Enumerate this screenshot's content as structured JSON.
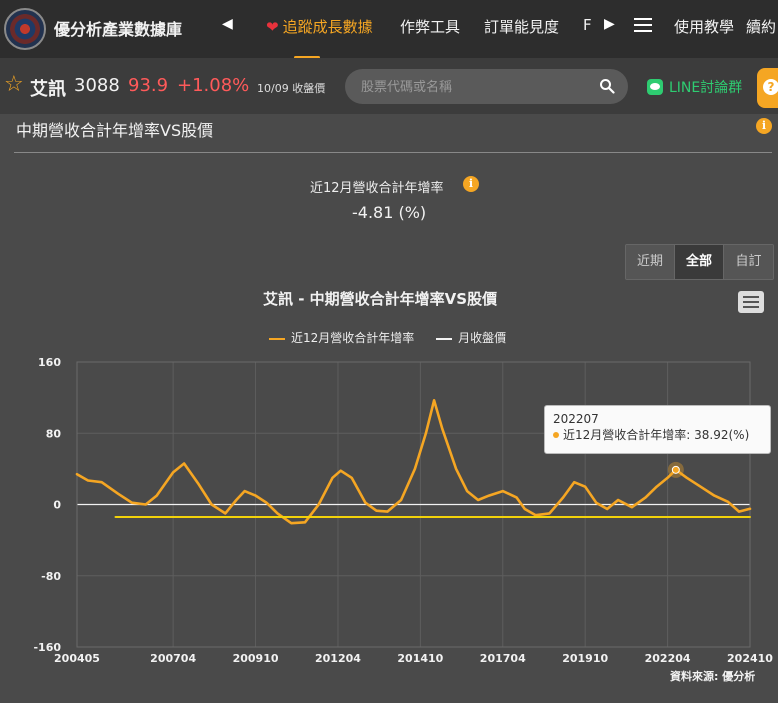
{
  "nav": {
    "brand": "優分析產業數據庫",
    "items": [
      "追蹤成長數據",
      "作弊工具",
      "訂單能見度",
      "F"
    ],
    "right_items": [
      "使用教學",
      "續約"
    ]
  },
  "stock": {
    "name": "艾訊",
    "code": "3088",
    "price": "93.9",
    "change": "+1.08%",
    "date_label": "10/09 收盤價",
    "line_label": "LINE討論群"
  },
  "search": {
    "placeholder": "股票代碼或名稱"
  },
  "section": {
    "title": "中期營收合計年增率VS股價"
  },
  "metric": {
    "label": "近12月營收合計年增率",
    "value": "-4.81 (%)"
  },
  "range_buttons": [
    "近期",
    "全部",
    "自訂"
  ],
  "tooltip": {
    "period": "202207",
    "text": "近12月營收合計年增率: 38.92(%)"
  },
  "source": "資料來源: 優分析",
  "colors": {
    "accent": "#f5a623",
    "up": "#ff5a5a",
    "price_line": "#f2d20a"
  },
  "chart_data": {
    "type": "line",
    "title": "艾訊 - 中期營收合計年增率VS股價",
    "legend": [
      "近12月營收合計年增率",
      "月收盤價"
    ],
    "x_ticks": [
      "200405",
      "200704",
      "200910",
      "201204",
      "201410",
      "201704",
      "201910",
      "202204",
      "202410"
    ],
    "y_ticks": [
      "160",
      "80",
      "0",
      "-80",
      "-160"
    ],
    "ylim": [
      -160,
      160
    ],
    "grid": true,
    "series": [
      {
        "name": "近12月營收合計年增率",
        "color": "#f5a623",
        "points": [
          [
            "2004-05",
            34
          ],
          [
            "2004-09",
            27
          ],
          [
            "2005-02",
            25
          ],
          [
            "2005-08",
            12
          ],
          [
            "2006-01",
            2
          ],
          [
            "2006-06",
            0
          ],
          [
            "2006-10",
            10
          ],
          [
            "2007-04",
            36
          ],
          [
            "2007-08",
            46
          ],
          [
            "2008-01",
            24
          ],
          [
            "2008-06",
            0
          ],
          [
            "2008-11",
            -10
          ],
          [
            "2009-03",
            5
          ],
          [
            "2009-06",
            15
          ],
          [
            "2009-10",
            10
          ],
          [
            "2010-02",
            2
          ],
          [
            "2010-06",
            -10
          ],
          [
            "2010-11",
            -21
          ],
          [
            "2011-04",
            -20
          ],
          [
            "2011-09",
            0
          ],
          [
            "2012-02",
            30
          ],
          [
            "2012-05",
            38
          ],
          [
            "2012-09",
            30
          ],
          [
            "2013-02",
            2
          ],
          [
            "2013-06",
            -7
          ],
          [
            "2013-10",
            -8
          ],
          [
            "2014-03",
            5
          ],
          [
            "2014-08",
            40
          ],
          [
            "2014-12",
            80
          ],
          [
            "2015-03",
            117
          ],
          [
            "2015-06",
            85
          ],
          [
            "2015-11",
            40
          ],
          [
            "2016-03",
            15
          ],
          [
            "2016-07",
            5
          ],
          [
            "2016-11",
            10
          ],
          [
            "2017-04",
            15
          ],
          [
            "2017-09",
            8
          ],
          [
            "2017-12",
            -5
          ],
          [
            "2018-04",
            -12
          ],
          [
            "2018-09",
            -10
          ],
          [
            "2019-02",
            8
          ],
          [
            "2019-06",
            25
          ],
          [
            "2019-10",
            20
          ],
          [
            "2020-02",
            2
          ],
          [
            "2020-06",
            -5
          ],
          [
            "2020-10",
            5
          ],
          [
            "2021-03",
            -3
          ],
          [
            "2021-08",
            8
          ],
          [
            "2021-12",
            20
          ],
          [
            "2022-04",
            30
          ],
          [
            "2022-07",
            38.92
          ],
          [
            "2022-11",
            30
          ],
          [
            "2023-04",
            20
          ],
          [
            "2023-09",
            10
          ],
          [
            "2024-02",
            3
          ],
          [
            "2024-06",
            -8
          ],
          [
            "2024-10",
            -4.81
          ]
        ]
      },
      {
        "name": "月收盤價",
        "color": "#f2d20a",
        "points": [
          [
            "2005-07",
            -14
          ],
          [
            "2024-10",
            -14
          ]
        ]
      }
    ]
  }
}
